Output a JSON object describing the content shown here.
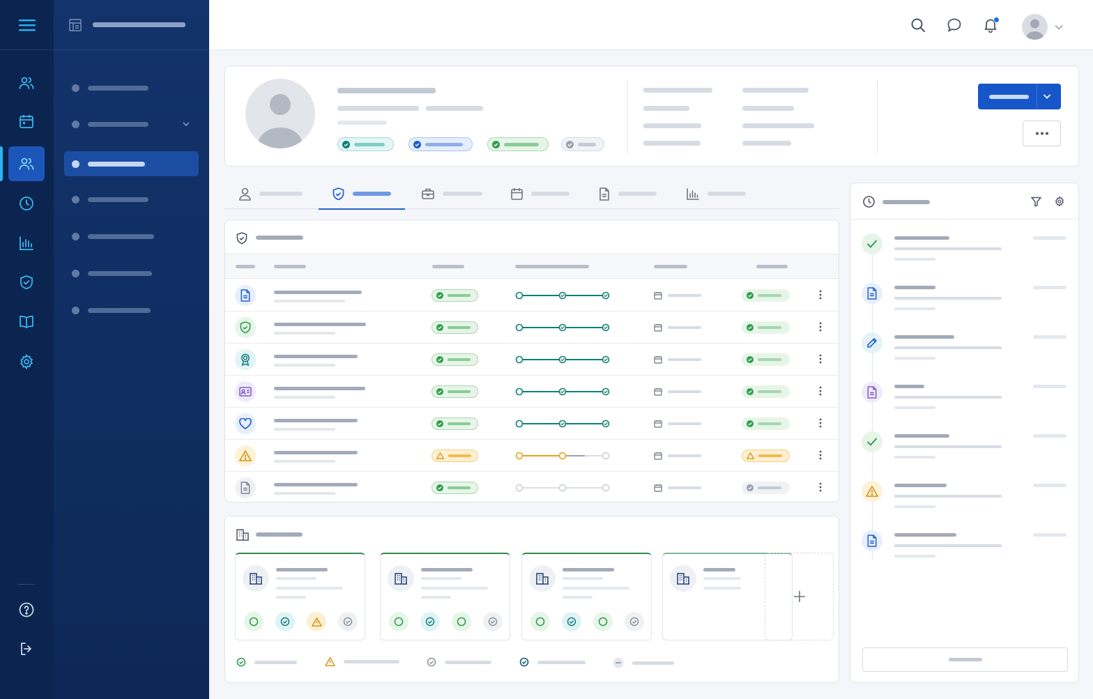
{
  "header": {
    "notification_dot_color": "#1e6fe0"
  },
  "rail": {
    "items": [
      "users-icon",
      "calendar-icon",
      "people-icon",
      "clock-icon",
      "chart-icon",
      "shield-icon",
      "book-icon",
      "gear-icon"
    ],
    "bottom": [
      "help-icon",
      "logout-icon"
    ],
    "active_index": 2
  },
  "sidebar": {
    "items": [
      {
        "name": "sidebar-item-1",
        "has_chevron": false
      },
      {
        "name": "sidebar-item-2",
        "has_chevron": true
      },
      {
        "name": "sidebar-item-3",
        "selected": true
      },
      {
        "name": "sidebar-item-4"
      },
      {
        "name": "sidebar-item-5"
      },
      {
        "name": "sidebar-item-6"
      },
      {
        "name": "sidebar-item-7"
      }
    ]
  },
  "profile": {
    "badges": [
      "teal",
      "blue",
      "green",
      "gray"
    ]
  },
  "tabs": [
    "person-icon",
    "shield-check-icon",
    "briefcase-icon",
    "calendar-icon",
    "document-icon",
    "chart-icon"
  ],
  "table": {
    "rows": [
      {
        "icon": "document-icon",
        "status": "ok",
        "progress": 1.0,
        "end": "ok"
      },
      {
        "icon": "shield-check-icon",
        "status": "ok",
        "progress": 1.0,
        "end": "ok"
      },
      {
        "icon": "award-icon",
        "status": "ok",
        "progress": 1.0,
        "end": "ok"
      },
      {
        "icon": "id-card-icon",
        "status": "ok",
        "progress": 1.0,
        "end": "ok"
      },
      {
        "icon": "heart-icon",
        "status": "ok",
        "progress": 1.0,
        "end": "ok"
      },
      {
        "icon": "warning-icon",
        "status": "warn",
        "progress": 0.5,
        "end": "warn"
      },
      {
        "icon": "document-gray-icon",
        "status": "ok",
        "progress": 0.0,
        "end": "gray"
      }
    ]
  },
  "facilities": {
    "cards": [
      {
        "statuses": [
          "green",
          "teal",
          "warn",
          "gray"
        ]
      },
      {
        "statuses": [
          "green",
          "teal",
          "green",
          "gray"
        ]
      },
      {
        "statuses": [
          "green",
          "teal",
          "green",
          "gray"
        ]
      },
      {
        "statuses": []
      }
    ],
    "legend": [
      "check-icon",
      "warning-icon",
      "clock-check-icon",
      "teal-check-icon",
      "minus-icon"
    ]
  },
  "timeline": {
    "events": [
      "check-icon",
      "document-icon",
      "pencil-icon",
      "purple-document-icon",
      "check-icon",
      "warning-icon",
      "document-icon"
    ]
  },
  "colors": {
    "primary": "#1e5fcf",
    "rail": "#0c2550",
    "sidebar": "#12336b",
    "green": "#2e9e4f",
    "teal": "#0f7f7a",
    "warn": "#e8a317"
  }
}
